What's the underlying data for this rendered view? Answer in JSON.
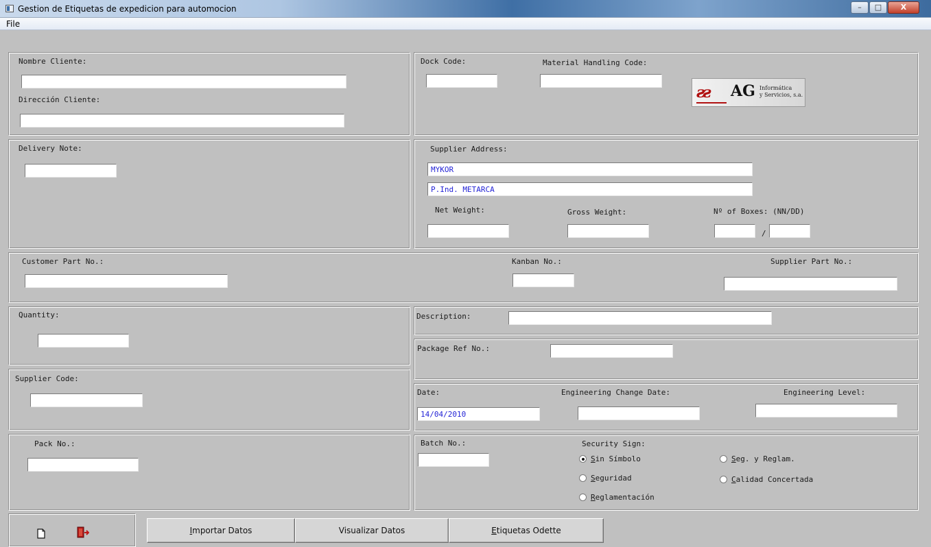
{
  "window": {
    "title": "Gestion de Etiquetas de expedicion para automocion",
    "minimize_glyph": "–",
    "maximize_glyph": "□",
    "close_glyph": "X"
  },
  "menu": {
    "file": "File"
  },
  "customer": {
    "name_label": "Nombre Cliente:",
    "name_value": "",
    "address_label": "Dirección Cliente:",
    "address_value": ""
  },
  "dock": {
    "dock_code_label": "Dock Code:",
    "dock_code_value": "",
    "mhc_label": "Material Handling Code:",
    "mhc_value": ""
  },
  "logo": {
    "mark": "ƨƨ",
    "name": "AG",
    "line1": "Informática",
    "line2": "y Servicios, s.a."
  },
  "delivery": {
    "label": "Delivery Note:",
    "value": ""
  },
  "supplier": {
    "address_label": "Supplier Address:",
    "address_line1": "MYKOR",
    "address_line2": "P.Ind. METARCA",
    "net_weight_label": "Net Weight:",
    "net_weight_value": "",
    "gross_weight_label": "Gross Weight:",
    "gross_weight_value": "",
    "boxes_label": "Nº of Boxes: (NN/DD)",
    "boxes_nn": "",
    "boxes_sep": "/",
    "boxes_dd": ""
  },
  "parts": {
    "customer_part_label": "Customer Part No.:",
    "customer_part_value": "",
    "kanban_label": "Kanban No.:",
    "kanban_value": "",
    "supplier_part_label": "Supplier Part No.:",
    "supplier_part_value": ""
  },
  "quantity": {
    "label": "Quantity:",
    "value": ""
  },
  "description": {
    "label": "Description:",
    "value": ""
  },
  "package_ref": {
    "label": "Package Ref No.:",
    "value": ""
  },
  "supplier_code": {
    "label": "Supplier Code:",
    "value": ""
  },
  "dates": {
    "date_label": "Date:",
    "date_value": "14/04/2010",
    "ecd_label": "Engineering Change Date:",
    "ecd_value": "",
    "eng_level_label": "Engineering Level:",
    "eng_level_value": ""
  },
  "pack": {
    "label": "Pack No.:",
    "value": ""
  },
  "batch": {
    "label": "Batch No.:",
    "value": ""
  },
  "security": {
    "label": "Security Sign:",
    "options": [
      {
        "key": "S",
        "rest": "in Símbolo",
        "selected": true
      },
      {
        "key": "S",
        "rest": "eguridad",
        "selected": false
      },
      {
        "key": "R",
        "rest": "eglamentación",
        "selected": false
      },
      {
        "key": "S",
        "rest": "eg. y Reglam.",
        "selected": false
      },
      {
        "key": "C",
        "rest": "alidad Concertada",
        "selected": false
      }
    ]
  },
  "buttons": {
    "importar_key": "I",
    "importar_rest": "mportar Datos",
    "visualizar": "Visualizar Datos",
    "etiquetas_key": "E",
    "etiquetas_rest": "tiquetas Odette"
  },
  "icons": {
    "new": "new-document-icon",
    "exit": "exit-icon"
  }
}
